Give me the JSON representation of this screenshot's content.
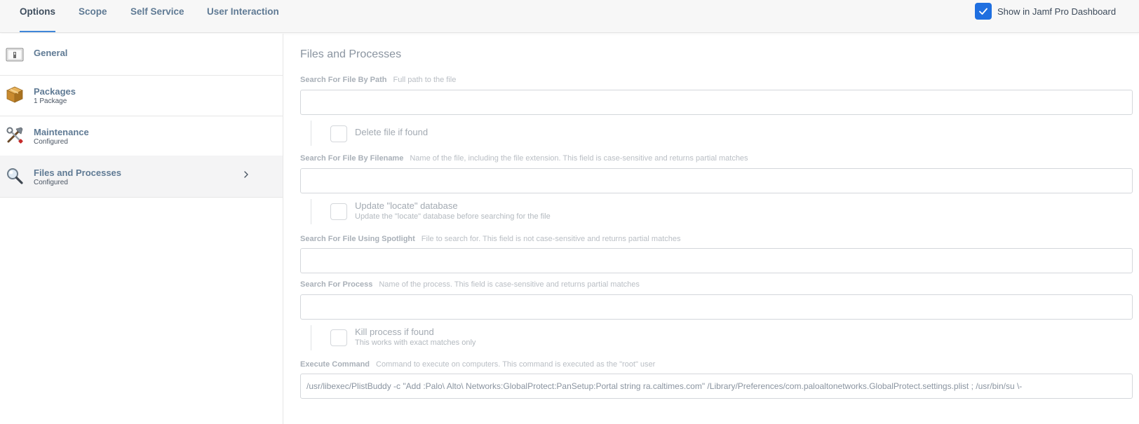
{
  "tabs": [
    {
      "label": "Options",
      "active": true
    },
    {
      "label": "Scope",
      "active": false
    },
    {
      "label": "Self Service",
      "active": false
    },
    {
      "label": "User Interaction",
      "active": false
    }
  ],
  "dashboard_toggle": {
    "label": "Show in Jamf Pro Dashboard",
    "checked": true,
    "color": "#1f6fe0"
  },
  "sidebar": {
    "items": [
      {
        "title": "General",
        "subtitle": "",
        "icon": "general-icon",
        "selected": false
      },
      {
        "title": "Packages",
        "subtitle": "1 Package",
        "icon": "package-box-icon",
        "selected": false
      },
      {
        "title": "Maintenance",
        "subtitle": "Configured",
        "icon": "tools-icon",
        "selected": false
      },
      {
        "title": "Files and Processes",
        "subtitle": "Configured",
        "icon": "magnifier-icon",
        "selected": true
      }
    ]
  },
  "main": {
    "section_title": "Files and Processes",
    "search_by_path": {
      "label": "Search For File By Path",
      "hint": "Full path to the file",
      "value": "",
      "checkbox": {
        "label": "Delete file if found",
        "checked": false
      }
    },
    "search_by_filename": {
      "label": "Search For File By Filename",
      "hint": "Name of the file, including the file extension. This field is case-sensitive and returns partial matches",
      "value": "",
      "checkbox": {
        "label": "Update \"locate\" database",
        "sublabel": "Update the \"locate\" database before searching for the file",
        "checked": false
      }
    },
    "search_spotlight": {
      "label": "Search For File Using Spotlight",
      "hint": "File to search for. This field is not case-sensitive and returns partial matches",
      "value": ""
    },
    "search_process": {
      "label": "Search For Process",
      "hint": "Name of the process. This field is case-sensitive and returns partial matches",
      "value": "",
      "checkbox": {
        "label": "Kill process if found",
        "sublabel": "This works with exact matches only",
        "checked": false
      }
    },
    "execute_command": {
      "label": "Execute Command",
      "hint": "Command to execute on computers. This command is executed as the \"root\" user",
      "value": "/usr/libexec/PlistBuddy -c \"Add :Palo\\ Alto\\ Networks:GlobalProtect:PanSetup:Portal string ra.caltimes.com\" /Library/Preferences/com.paloaltonetworks.GlobalProtect.settings.plist ; /usr/bin/su \\-"
    }
  }
}
